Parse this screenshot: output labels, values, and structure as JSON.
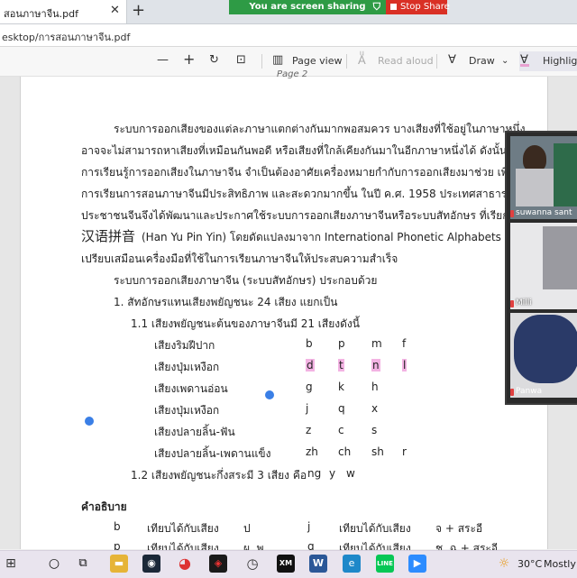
{
  "browser": {
    "tab_title": "สอนภาษาจีน.pdf",
    "tab_close": "✕",
    "new_tab": "+",
    "share_banner": "You are screen sharing",
    "stop_share": "Stop Share",
    "address": "esktop/การสอนภาษาจีน.pdf"
  },
  "pdf_toolbar": {
    "page_view": "Page view",
    "read_aloud": "Read aloud",
    "draw": "Draw",
    "highlight": "Highligh"
  },
  "document": {
    "page_label": "Page 2",
    "para1": [
      "ระบบการออกเสียงของแต่ละภาษาแตกต่างกันมากพอสมควร บางเสียงที่ใช้อยู่ในภาษาหนึ่ง",
      "อาจจะไม่สามารถหาเสียงที่เหมือนกันพอดี หรือเสียงที่ใกล้เคียงกันมาในอีกภาษาหนึ่งได้ ดังนั้น",
      "การเรียนรู้การออกเสียงในภาษาจีน จำเป็นต้องอาศัยเครื่องหมายกำกับการออกเสียงมาช่วย เพื่อให้",
      "การเรียนการสอนภาษาจีนมีประสิทธิภาพ และสะดวกมากขึ้น ในปี ค.ศ. 1958 ประเทศสาธารณรัฐ",
      "ประชาชนจีนจึงได้พัฒนาและประกาศใช้ระบบการออกเสียงภาษาจีนหรือระบบสัทอักษร ที่เรียกว่า",
      "(Han Yu Pin Yin) โดยดัดแปลงมาจาก International Phonetic Alphabets ซึ่ง",
      "เปรียบเสมือนเครื่องมือที่ใช้ในการเรียนภาษาจีนให้ประสบความสำเร็จ"
    ],
    "hanyu_chinese": "汉语拼音",
    "para2": "ระบบการออกเสียงภาษาจีน (ระบบสัทอักษร) ประกอบด้วย",
    "item1": "1. สัทอักษรแทนเสียงพยัญชนะ 24 เสียง แยกเป็น",
    "item11": "1.1  เสียงพยัญชนะต้นของภาษาจีนมี 21 เสียงดังนี้",
    "consonant_rows": [
      {
        "label": "เสียงริมฝีปาก",
        "letters": [
          "b",
          "p",
          "m",
          "f"
        ]
      },
      {
        "label": "เสียงปุ่มเหงือก",
        "letters": [
          "d",
          "t",
          "n",
          "l"
        ]
      },
      {
        "label": "เสียงเพดานอ่อน",
        "letters": [
          "g",
          "k",
          "h"
        ]
      },
      {
        "label": "เสียงปุ่มเหงือก",
        "letters": [
          "j",
          "q",
          "x"
        ]
      },
      {
        "label": "เสียงปลายลิ้น-ฟัน",
        "letters": [
          "z",
          "c",
          "s"
        ]
      },
      {
        "label": "เสียงปลายลิ้น-เพดานแข็ง",
        "letters": [
          "zh",
          "ch",
          "sh",
          "r"
        ]
      }
    ],
    "item12": "1.2  เสียงพยัญชนะกึ่งสระมี 3 เสียง คือ",
    "item12_letters": [
      "ng",
      "y",
      "w"
    ],
    "explanation_heading": "คำอธิบาย",
    "explanation_rows": [
      [
        "b",
        "เทียบได้กับเสียง",
        "ป",
        "j",
        "เทียบได้กับเสียง",
        "จ + สระอี"
      ],
      [
        "p",
        "เทียบได้กับเสียง",
        "ผ, พ",
        "q",
        "เทียบได้กับเสียง",
        "ช, ฉ + สระอี"
      ]
    ]
  },
  "video_panel": {
    "participants": [
      "suwanna sant",
      "Milli",
      "Panwa"
    ]
  },
  "taskbar": {
    "weather_temp": "30°C",
    "weather_desc": "Mostly c"
  },
  "colors": {
    "share_green": "#2e9b45",
    "stop_red": "#d93025",
    "highlight_pink": "#f3b3e3",
    "pointer_blue": "#3a7fe6"
  }
}
